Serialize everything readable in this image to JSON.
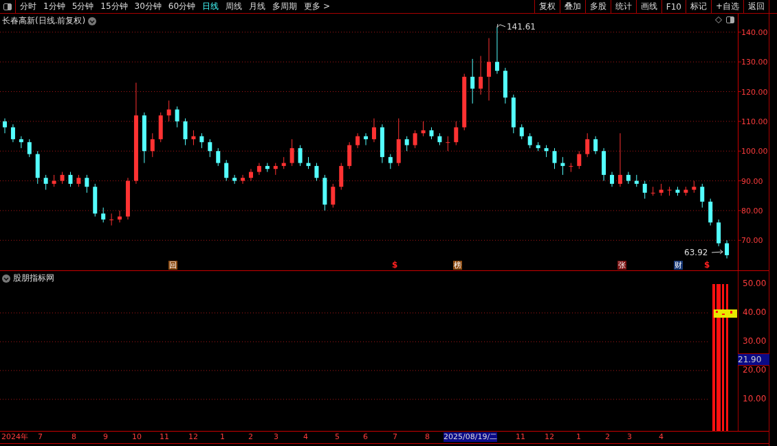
{
  "toolbar": {
    "periods": [
      {
        "label": "分时",
        "selected": false
      },
      {
        "label": "1分钟",
        "selected": false
      },
      {
        "label": "5分钟",
        "selected": false
      },
      {
        "label": "15分钟",
        "selected": false
      },
      {
        "label": "30分钟",
        "selected": false
      },
      {
        "label": "60分钟",
        "selected": false
      },
      {
        "label": "日线",
        "selected": true
      },
      {
        "label": "周线",
        "selected": false
      },
      {
        "label": "月线",
        "selected": false
      },
      {
        "label": "多周期",
        "selected": false
      },
      {
        "label": "更多 >",
        "selected": false
      }
    ],
    "buttons": [
      "复权",
      "叠加",
      "多股",
      "统计",
      "画线",
      "F10",
      "标记",
      "+自选",
      "返回"
    ]
  },
  "price_chart": {
    "title": "长春高新(日线.前复权)",
    "high_label": "141.61",
    "low_label": "63.92",
    "chart_data": {
      "type": "candlestick",
      "grid": true,
      "ylim": [
        59.9,
        146.2
      ],
      "yticks": [
        {
          "value": 140,
          "label": "140.00"
        },
        {
          "value": 130,
          "label": "130.00"
        },
        {
          "value": 120,
          "label": "120.00"
        },
        {
          "value": 110,
          "label": "110.00"
        },
        {
          "value": 100,
          "label": "100.00"
        },
        {
          "value": 90,
          "label": "90.00"
        },
        {
          "value": 80,
          "label": "80.00"
        },
        {
          "value": 70,
          "label": "70.00"
        }
      ],
      "categories": [
        null,
        null,
        null,
        null,
        null,
        null,
        null,
        null,
        null,
        null,
        null,
        null,
        null,
        null,
        null,
        null,
        null,
        null,
        null,
        null,
        null,
        null,
        null,
        null,
        null,
        null,
        null,
        null,
        null,
        null,
        null,
        null,
        null,
        null,
        null,
        null,
        null,
        null,
        null,
        null,
        null,
        null,
        null,
        null,
        null,
        null,
        null,
        null,
        null,
        null,
        null,
        null,
        null,
        null,
        null,
        null,
        null,
        null,
        null,
        null,
        null,
        null,
        null,
        null,
        null,
        null,
        null,
        null,
        null,
        null,
        null,
        null,
        null,
        null,
        null,
        null,
        null,
        null,
        null,
        null,
        null,
        null,
        null,
        null,
        null,
        null,
        null,
        null,
        null
      ],
      "ohlc": [
        [
          110,
          111,
          106,
          108
        ],
        [
          108,
          109,
          103,
          104
        ],
        [
          104,
          105,
          101,
          103
        ],
        [
          103,
          104,
          98,
          99
        ],
        [
          99,
          100,
          89,
          91
        ],
        [
          91,
          92,
          87,
          89
        ],
        [
          89,
          92,
          88,
          90
        ],
        [
          90,
          93,
          89,
          92
        ],
        [
          92,
          93,
          88,
          89
        ],
        [
          89,
          92,
          88,
          91
        ],
        [
          91,
          92,
          86,
          88
        ],
        [
          88,
          89,
          78,
          79
        ],
        [
          79,
          81,
          76,
          77
        ],
        [
          77,
          79,
          75,
          77
        ],
        [
          77,
          80,
          76,
          78
        ],
        [
          78,
          91,
          77,
          90
        ],
        [
          90,
          123,
          89,
          112
        ],
        [
          112,
          113,
          96,
          100
        ],
        [
          100,
          106,
          98,
          104
        ],
        [
          104,
          113,
          103,
          112
        ],
        [
          112,
          117,
          110,
          114
        ],
        [
          114,
          115,
          108,
          110
        ],
        [
          110,
          111,
          102,
          104
        ],
        [
          104,
          107,
          102,
          105
        ],
        [
          105,
          106,
          101,
          103
        ],
        [
          103,
          104,
          98,
          100
        ],
        [
          100,
          101,
          95,
          96
        ],
        [
          96,
          97,
          90,
          91
        ],
        [
          91,
          92,
          89,
          90
        ],
        [
          90,
          92,
          89,
          91
        ],
        [
          91,
          94,
          90,
          93
        ],
        [
          93,
          96,
          92,
          95
        ],
        [
          95,
          96,
          93,
          94
        ],
        [
          94,
          96,
          92,
          95
        ],
        [
          95,
          98,
          94,
          96
        ],
        [
          96,
          104,
          95,
          101
        ],
        [
          101,
          102,
          95,
          96
        ],
        [
          96,
          98,
          94,
          95
        ],
        [
          95,
          96,
          90,
          91
        ],
        [
          91,
          92,
          80,
          82
        ],
        [
          82,
          89,
          81,
          88
        ],
        [
          88,
          96,
          87,
          95
        ],
        [
          95,
          103,
          94,
          102
        ],
        [
          102,
          106,
          101,
          105
        ],
        [
          105,
          106,
          102,
          104
        ],
        [
          104,
          111,
          103,
          108
        ],
        [
          108,
          109,
          96,
          98
        ],
        [
          98,
          99,
          94,
          96
        ],
        [
          96,
          111,
          95,
          104
        ],
        [
          104,
          105,
          100,
          102
        ],
        [
          102,
          107,
          101,
          106
        ],
        [
          106,
          110,
          105,
          107
        ],
        [
          107,
          108,
          104,
          105
        ],
        [
          105,
          106,
          102,
          103
        ],
        [
          103,
          105,
          100,
          103
        ],
        [
          103,
          110,
          102,
          108
        ],
        [
          108,
          126,
          107,
          125
        ],
        [
          125,
          131,
          116,
          121
        ],
        [
          121,
          132,
          119,
          125
        ],
        [
          125,
          138,
          117,
          130
        ],
        [
          130,
          141.61,
          126,
          127
        ],
        [
          127,
          128,
          116,
          118
        ],
        [
          118,
          119,
          106,
          108
        ],
        [
          108,
          109,
          104,
          105
        ],
        [
          105,
          106,
          101,
          102
        ],
        [
          102,
          103,
          100,
          101
        ],
        [
          101,
          102,
          98,
          100
        ],
        [
          100,
          101,
          94,
          96
        ],
        [
          96,
          98,
          92,
          95
        ],
        [
          95,
          96,
          93,
          95
        ],
        [
          95,
          100,
          94,
          99
        ],
        [
          99,
          106,
          98,
          104
        ],
        [
          104,
          105,
          99,
          100
        ],
        [
          100,
          101,
          90,
          92
        ],
        [
          92,
          93,
          88,
          89
        ],
        [
          89,
          106,
          88,
          92
        ],
        [
          92,
          93,
          89,
          90
        ],
        [
          90,
          92,
          88,
          89
        ],
        [
          89,
          90,
          84,
          86
        ],
        [
          86,
          88,
          85,
          86
        ],
        [
          86,
          89,
          85,
          87
        ],
        [
          87,
          88,
          85,
          87
        ],
        [
          87,
          88,
          85,
          86
        ],
        [
          86,
          88,
          85,
          87
        ],
        [
          87,
          90,
          86,
          88
        ],
        [
          88,
          89,
          81,
          83
        ],
        [
          83,
          84,
          75,
          76
        ],
        [
          76,
          77,
          68,
          69
        ],
        [
          69,
          70,
          63.92,
          65
        ]
      ]
    },
    "markers": [
      {
        "label": "回",
        "kind": "tag",
        "color": "#8b4a10"
      },
      {
        "label": "$",
        "kind": "arrow",
        "color": "#ff2020"
      },
      {
        "label": "榜",
        "kind": "tag",
        "color": "#8b4a10"
      },
      {
        "label": "张",
        "kind": "tag",
        "color": "#7a1010"
      },
      {
        "label": "财",
        "kind": "tag",
        "color": "#1a3a78"
      },
      {
        "label": "$",
        "kind": "arrow",
        "color": "#ff2020"
      }
    ]
  },
  "indicator_panel": {
    "title": "股朋指标网",
    "axis_labels": [
      "50.00",
      "40.00",
      "30.00",
      "20.00",
      "10.00"
    ],
    "current_value": "21.90"
  },
  "time_axis": [
    {
      "label": "2024年",
      "selected": false
    },
    {
      "label": "7",
      "selected": false
    },
    {
      "label": "8",
      "selected": false
    },
    {
      "label": "9",
      "selected": false
    },
    {
      "label": "10",
      "selected": false
    },
    {
      "label": "11",
      "selected": false
    },
    {
      "label": "12",
      "selected": false
    },
    {
      "label": "1",
      "selected": false
    },
    {
      "label": "2",
      "selected": false
    },
    {
      "label": "3",
      "selected": false
    },
    {
      "label": "4",
      "selected": false
    },
    {
      "label": "5",
      "selected": false
    },
    {
      "label": "6",
      "selected": false
    },
    {
      "label": "7",
      "selected": false
    },
    {
      "label": "8",
      "selected": false
    },
    {
      "label": "2025/08/19/二",
      "selected": true
    },
    {
      "label": "11",
      "selected": false
    },
    {
      "label": "12",
      "selected": false
    },
    {
      "label": "1",
      "selected": false
    },
    {
      "label": "2",
      "selected": false
    },
    {
      "label": "3",
      "selected": false
    },
    {
      "label": "4",
      "selected": false
    }
  ]
}
